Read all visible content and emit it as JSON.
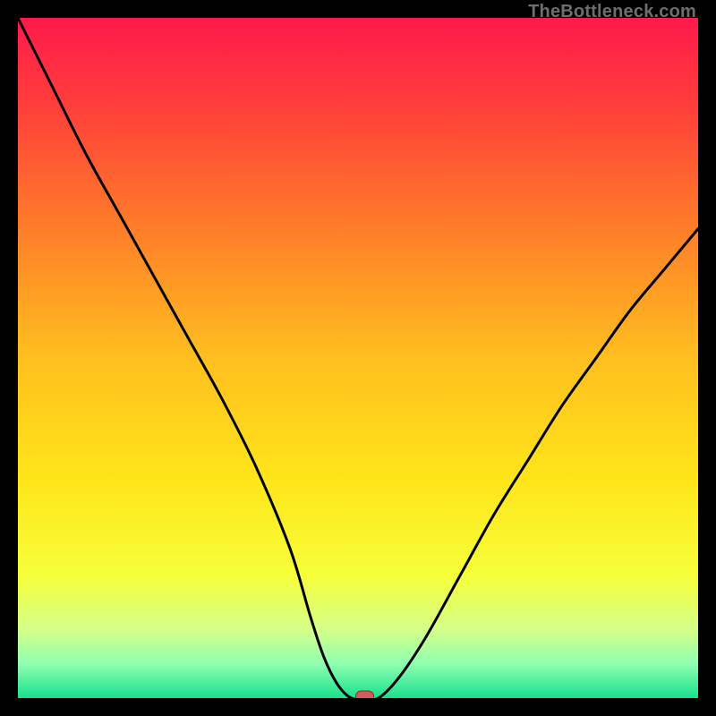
{
  "watermark": "TheBottleneck.com",
  "chart_data": {
    "type": "line",
    "title": "",
    "xlabel": "",
    "ylabel": "",
    "xlim": [
      0,
      100
    ],
    "ylim": [
      0,
      100
    ],
    "grid": false,
    "legend": false,
    "series": [
      {
        "name": "bottleneck-curve",
        "x": [
          0,
          5,
          10,
          15,
          20,
          25,
          30,
          35,
          40,
          43,
          45,
          47,
          49,
          51,
          53,
          56,
          60,
          65,
          70,
          75,
          80,
          85,
          90,
          95,
          100
        ],
        "y": [
          100,
          90,
          80,
          71,
          62,
          53,
          44,
          34,
          22,
          12,
          6,
          2,
          0,
          0,
          0,
          3,
          9,
          18,
          27,
          35,
          43,
          50,
          57,
          63,
          69
        ]
      }
    ],
    "marker": {
      "name": "optimal-point",
      "x": 51,
      "y": 0,
      "color": "#d15a5a"
    },
    "background_gradient": {
      "stops": [
        {
          "offset": 0.0,
          "color": "#ff1a4b"
        },
        {
          "offset": 0.12,
          "color": "#ff3b3b"
        },
        {
          "offset": 0.3,
          "color": "#ff7a2a"
        },
        {
          "offset": 0.5,
          "color": "#ffbf1f"
        },
        {
          "offset": 0.68,
          "color": "#ffe51a"
        },
        {
          "offset": 0.82,
          "color": "#f6ff3a"
        },
        {
          "offset": 0.9,
          "color": "#d4ff8a"
        },
        {
          "offset": 0.95,
          "color": "#8effb0"
        },
        {
          "offset": 1.0,
          "color": "#18e08e"
        }
      ]
    }
  }
}
